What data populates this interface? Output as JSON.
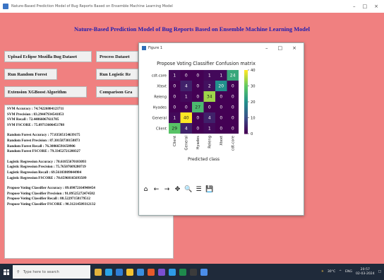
{
  "window": {
    "title": "Nature-Based Prediction Model of Bug Reports Based on Ensemble Machine Learning Model",
    "minimize_icon": "–",
    "maximize_icon": "□",
    "close_icon": "×"
  },
  "heading": "Nature-Based Prediction Model of Bug Reports Based on Ensemble Machine Learning Model",
  "buttons": {
    "upload": "Upload Eclipse Mozilla Bug Dataset",
    "process": "Process Dataset",
    "random_forest": "Run Random Forest",
    "logistic": "Run Logistic Re",
    "xgboost": "Extension XGBoost Algorithm",
    "comparison": "Comparison Gra"
  },
  "results": {
    "svm": [
      "SVM Accuracy : 74.74226804123711",
      "SVM Precision : 83.29447934541853",
      "SVM Recall : 72.44866067611705",
      "SVM FSCORE : 75.09713606451788"
    ],
    "rf": [
      "Random Forest Accuracy : 77.83505154639175",
      "Random Forest Precision : 87.30158730158873",
      "Random Forest Recall : 76.30866591650906",
      "Random Forest FSCORE : 79.33452721280327"
    ],
    "lr": [
      "Logistic Regression Accuracy : 70.61855670103093",
      "Logistic Regression Precision : 75.76507609280719",
      "Logistic Regression Recall : 69.56103809044984",
      "Logistic Regression FSCORE : 70.65968165693509"
    ],
    "vc": [
      "Propose Voting Classifier Accuracy : 89.69072164948454",
      "Propose Voting Classifier Precision : 91.89525272474582",
      "Propose Voting Classifier Recall : 88.52297158179512",
      "Propose Voting Classifier FSCORE : 90.31214509312132"
    ]
  },
  "figure": {
    "title": "Figure 1",
    "minimize_icon": "–",
    "maximize_icon": "□",
    "close_icon": "×",
    "toolbar": [
      "⌂",
      "←",
      "→",
      "✥",
      "🔍",
      "☰",
      "💾"
    ]
  },
  "chart_data": {
    "type": "heatmap",
    "title": "Propose Voting Classifier Confusion matrix",
    "xlabel": "Predicted class",
    "ylabel": "",
    "rows": [
      "cdt-core",
      "Xtext",
      "Releng",
      "Hyades",
      "General",
      "Client"
    ],
    "cols": [
      "Client",
      "General",
      "Hyades",
      "Releng",
      "Xtext",
      "cdt-core"
    ],
    "values": [
      [
        1,
        0,
        0,
        1,
        1,
        24
      ],
      [
        0,
        4,
        0,
        2,
        20,
        0
      ],
      [
        0,
        1,
        0,
        34,
        0,
        0
      ],
      [
        0,
        0,
        27,
        0,
        0,
        0
      ],
      [
        1,
        40,
        0,
        4,
        0,
        0
      ],
      [
        29,
        4,
        0,
        1,
        0,
        0
      ]
    ],
    "colorbar_ticks": [
      0,
      10,
      20,
      30,
      40
    ],
    "vmin": 0,
    "vmax": 40,
    "colormap": "viridis"
  },
  "taskbar": {
    "search_placeholder": "Type here to search",
    "weather": "30°C",
    "lang": "ENG",
    "time": "20:57",
    "date": "02-03-2024",
    "app_colors": [
      "#e3b23c",
      "#2aa4e6",
      "#2f7fd6",
      "#f2c230",
      "#3a8ee0",
      "#e55a2b",
      "#7b4fd0",
      "#2e9be6",
      "#1e8a4c",
      "#3b3b3b",
      "#4b8de8"
    ]
  }
}
